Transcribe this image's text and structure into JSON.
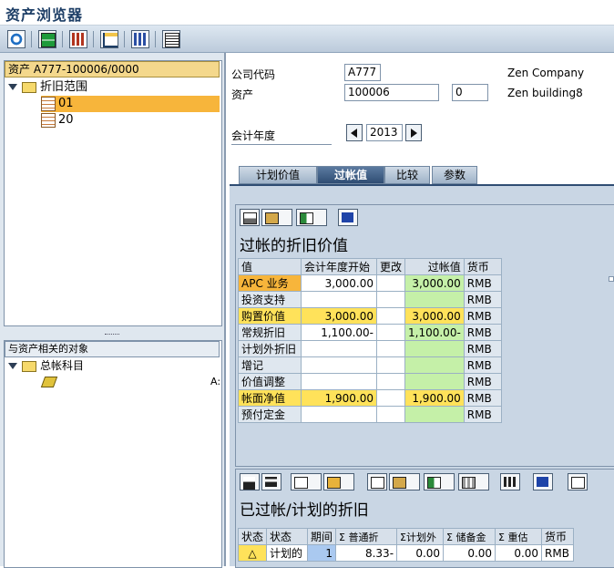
{
  "window": {
    "title": "资产浏览器"
  },
  "toolbar": {
    "icons": [
      "refresh-icon",
      "layout-icon",
      "calculator-icon",
      "tree-icon",
      "chart-icon",
      "list-icon"
    ]
  },
  "left": {
    "asset_header": "资产 A777-100006/0000",
    "tree_root": "折旧范围",
    "tree_items": [
      "01",
      "20"
    ],
    "related_header": "与资产相关的对象",
    "related_root": "总帐科目",
    "related_value": "A:"
  },
  "header": {
    "company_code_label": "公司代码",
    "company_code": "A777",
    "company_name": "Zen Company",
    "asset_label": "资产",
    "asset_number": "100006",
    "asset_sub": "0",
    "asset_name": "Zen building8",
    "fiscal_year_label": "会计年度",
    "fiscal_year": "2013"
  },
  "tabs": [
    {
      "label": "计划价值",
      "active": false
    },
    {
      "label": "过帐值",
      "active": true
    },
    {
      "label": "比较",
      "active": false
    },
    {
      "label": "参数",
      "active": false
    }
  ],
  "posted_values": {
    "title": "过帐的折旧价值",
    "columns": [
      "值",
      "会计年度开始",
      "更改",
      "过帐值",
      "货币"
    ],
    "rows": [
      {
        "name": "APC 业务",
        "start": "3,000.00",
        "change": "",
        "posted": "3,000.00",
        "currency": "RMB",
        "highlight": "orange"
      },
      {
        "name": "投资支持",
        "start": "",
        "change": "",
        "posted": "",
        "currency": "RMB",
        "highlight": ""
      },
      {
        "name": "购置价值",
        "start": "3,000.00",
        "change": "",
        "posted": "3,000.00",
        "currency": "RMB",
        "highlight": "yellow"
      },
      {
        "name": "常规折旧",
        "start": "1,100.00-",
        "change": "",
        "posted": "1,100.00-",
        "currency": "RMB",
        "highlight": ""
      },
      {
        "name": "计划外折旧",
        "start": "",
        "change": "",
        "posted": "",
        "currency": "RMB",
        "highlight": ""
      },
      {
        "name": "增记",
        "start": "",
        "change": "",
        "posted": "",
        "currency": "RMB",
        "highlight": ""
      },
      {
        "name": "价值调整",
        "start": "",
        "change": "",
        "posted": "",
        "currency": "RMB",
        "highlight": ""
      },
      {
        "name": "帐面净值",
        "start": "1,900.00",
        "change": "",
        "posted": "1,900.00",
        "currency": "RMB",
        "highlight": "yellow"
      },
      {
        "name": "预付定金",
        "start": "",
        "change": "",
        "posted": "",
        "currency": "RMB",
        "highlight": ""
      }
    ]
  },
  "planned": {
    "title": "已过帐/计划的折旧",
    "columns": [
      "状态",
      "状态",
      "期间",
      "Σ 普通折",
      "Σ计划外",
      "Σ 储备金",
      "Σ 重估",
      "货币"
    ],
    "rows": [
      {
        "status_icon": "△",
        "status": "计划的",
        "period": "1",
        "normal": "8.33-",
        "unplanned": "0.00",
        "reserve": "0.00",
        "revalue": "0.00",
        "currency": "RMB"
      }
    ]
  },
  "colors": {
    "accent": "#2f4d73",
    "yellow": "#ffe25a",
    "green": "#c5f0a8",
    "orange": "#f7b53b"
  }
}
